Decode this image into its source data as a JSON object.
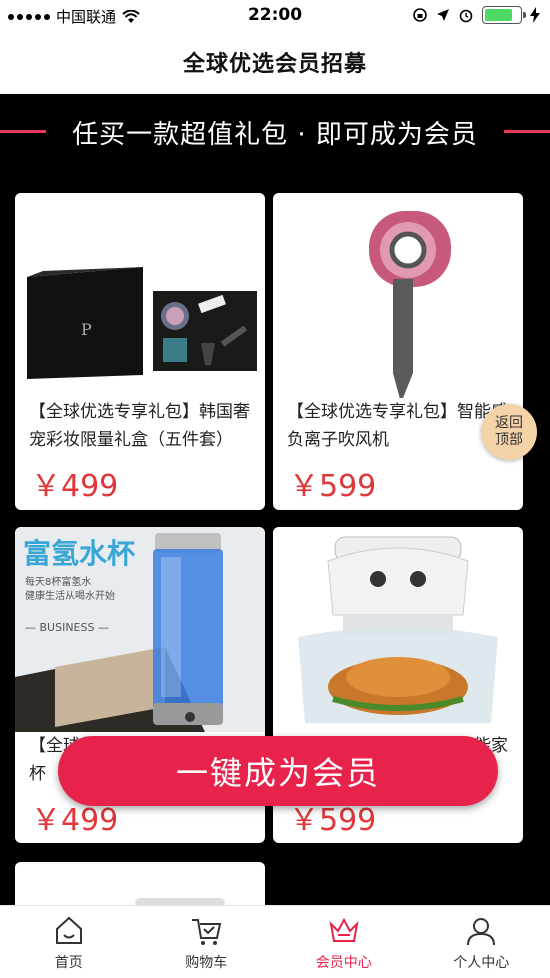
{
  "status_bar": {
    "carrier": "中国联通",
    "time": "22:00"
  },
  "nav": {
    "title": "全球优选会员招募"
  },
  "banner": {
    "text": "任买一款超值礼包 · 即可成为会员"
  },
  "products": [
    {
      "title": "【全球优选专享礼包】韩国奢宠彩妆限量礼盒（五件套）",
      "price": "￥499"
    },
    {
      "title": "【全球优选专享礼包】智能感负离子吹风机",
      "price": "￥599"
    },
    {
      "title": "【全球优选专享礼包】富氢水杯",
      "price": "￥499",
      "image_text": {
        "headline": "富氢水杯",
        "line1": "每天8杯富氢水",
        "line2": "健康生活从喝水开始",
        "line3": "— BUSINESS —"
      }
    },
    {
      "title": "【全球优选专享礼包】智能家",
      "price": "￥599"
    }
  ],
  "back_to_top": {
    "line1": "返回",
    "line2": "顶部"
  },
  "cta": {
    "label": "一键成为会员"
  },
  "tabs": [
    {
      "label": "首页",
      "icon": "home-icon",
      "active": false
    },
    {
      "label": "购物车",
      "icon": "cart-icon",
      "active": false
    },
    {
      "label": "会员中心",
      "icon": "crown-icon",
      "active": true
    },
    {
      "label": "个人中心",
      "icon": "user-icon",
      "active": false
    }
  ],
  "colors": {
    "accent": "#e8234b",
    "price": "#e0373b",
    "banner_line": "#e63a58"
  }
}
